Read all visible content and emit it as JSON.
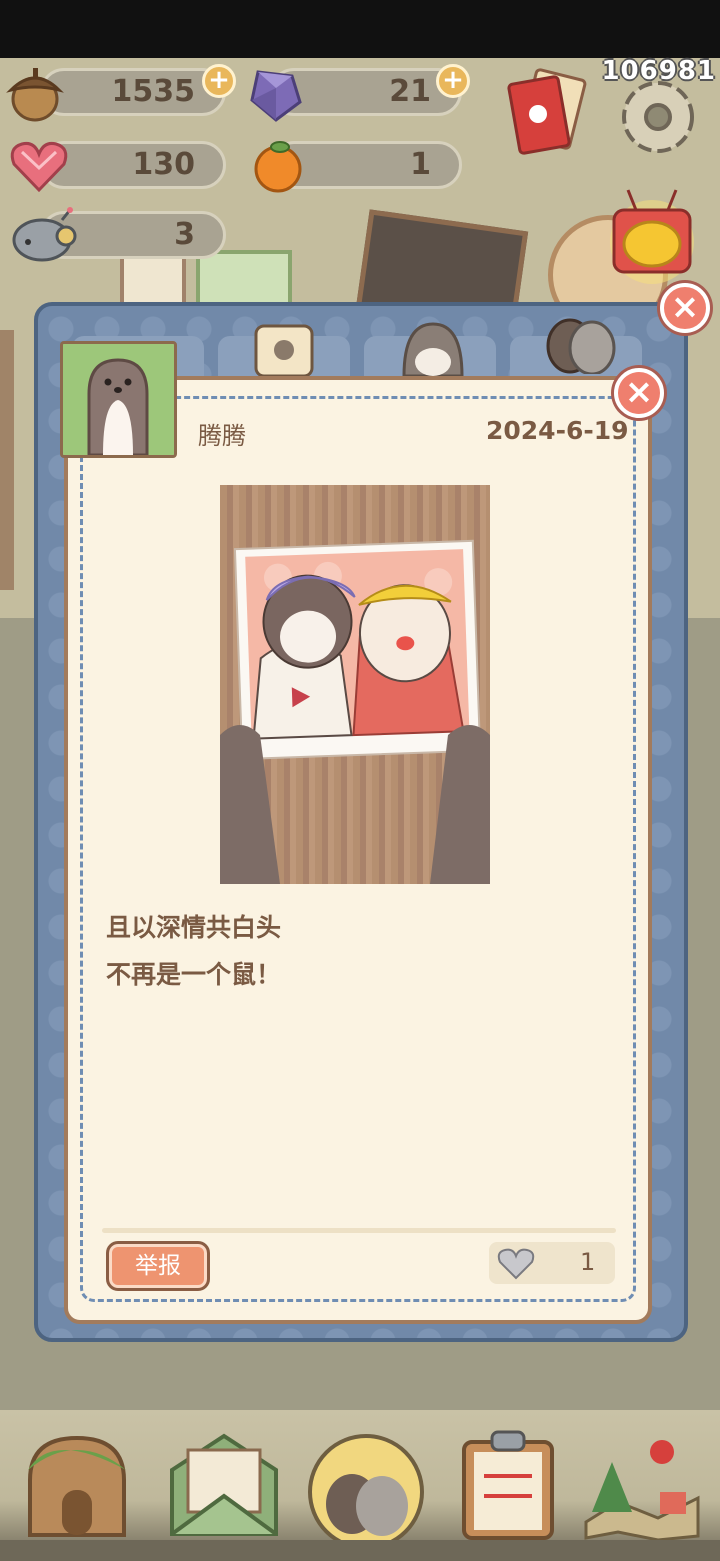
{
  "resources": {
    "acorns": {
      "icon": "acorn-icon",
      "value": "1535"
    },
    "gems": {
      "icon": "crystal-icon",
      "value": "21"
    },
    "hearts": {
      "icon": "crystal-heart-icon",
      "value": "130"
    },
    "oranges": {
      "icon": "orange-icon",
      "value": "1"
    },
    "robots": {
      "icon": "robot-head-icon",
      "value": "3"
    }
  },
  "score": "106981",
  "post": {
    "username": "腾腾",
    "date": "2024-6-19",
    "lines": [
      "且以深情共白头",
      "不再是一个鼠！"
    ],
    "report_label": "举报",
    "likes": "1"
  },
  "colors": {
    "panel_blue": "#7189a9",
    "card_cream": "#fbf3e2",
    "report_orange": "#ee9470",
    "close_red": "#ef7f6e"
  }
}
